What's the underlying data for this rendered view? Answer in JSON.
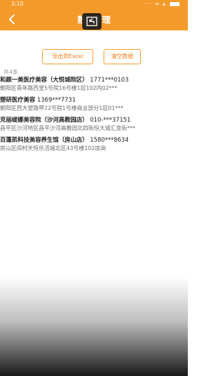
{
  "status_bar": {
    "time": "3:10",
    "icons_text": "··· ≈ ▴"
  },
  "header": {
    "title": "数据管理",
    "back_icon": "chevron-left-icon",
    "overlay_icon": "window-restore-icon"
  },
  "actions": {
    "export_label": "导出到Excel",
    "clear_label": "清空数据"
  },
  "summary": {
    "count_label": "共4条"
  },
  "records": [
    {
      "name": "和颜一美医疗美容（大悦城院区）",
      "phone": "1771***0103",
      "address": "朝阳区青年路西里5号院16号楼1层102内02***"
    },
    {
      "name": "塑研医疗美容",
      "phone": "1369***7731",
      "address": "朝阳区西大望路甲22号院1号楼商业部分1层01***"
    },
    {
      "name": "克丽缇娜美容院（沙河高教园店）",
      "phone": "010-***37151",
      "address": "昌平区沙河地区昌平沙河高教园北四街恒大城汇金街***"
    },
    {
      "name": "百蓬凯科技美容养生馆（房山店）",
      "phone": "1580***8634",
      "address": "房山区阎村天恒乐活城北区43号楼102底商"
    }
  ],
  "colors": {
    "accent": "#f49a2a",
    "button_text": "#f07c1a"
  }
}
